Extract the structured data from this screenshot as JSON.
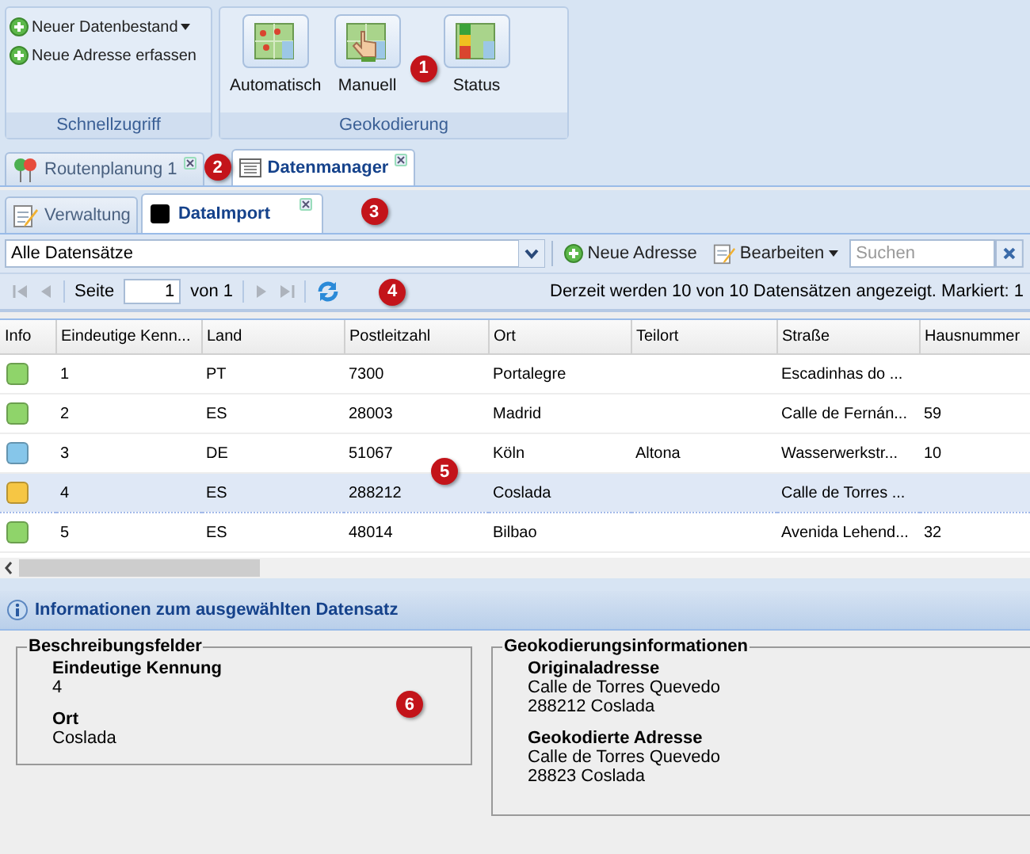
{
  "quick_access": {
    "title": "Schnellzugriff",
    "items": [
      {
        "label": "Neuer Datenbestand",
        "dropdown": true
      },
      {
        "label": "Neue Adresse erfassen",
        "dropdown": false
      }
    ]
  },
  "geocoding": {
    "title": "Geokodierung",
    "buttons": [
      {
        "label": "Automatisch",
        "kind": "auto"
      },
      {
        "label": "Manuell",
        "kind": "manual"
      },
      {
        "label": "Status",
        "kind": "status"
      }
    ],
    "callout": "1"
  },
  "main_tabs": {
    "items": [
      {
        "label": "Routenplanung 1",
        "kind": "pins",
        "selected": false
      },
      {
        "label": "Datenmanager",
        "kind": "window",
        "selected": true
      }
    ],
    "callout": "2"
  },
  "sub_tabs": {
    "items": [
      {
        "label": "Verwaltung",
        "kind": "notepad",
        "selected": false
      },
      {
        "label": "DataImport",
        "kind": "square",
        "selected": true
      }
    ],
    "callout": "3"
  },
  "toolbar": {
    "filter": "Alle Datensätze",
    "new_button": "Neue Adresse",
    "edit_button": "Bearbeiten",
    "search_placeholder": "Suchen"
  },
  "paging": {
    "page_label": "Seite",
    "page": "1",
    "of_label": "von 1",
    "nav_disabled": true,
    "status": "Derzeit werden 10 von 10 Datensätzen angezeigt. Markiert: 1",
    "callout": "4"
  },
  "grid": {
    "columns": [
      "Info",
      "Eindeutige Kenn...",
      "Land",
      "Postleitzahl",
      "Ort",
      "Teilort",
      "Straße",
      "Hausnummer"
    ],
    "rows": [
      {
        "color": "#8fd46a",
        "selected": false,
        "cells": [
          "",
          "1",
          "PT",
          "7300",
          "Portalegre",
          "",
          "Escadinhas do ...",
          ""
        ]
      },
      {
        "color": "#8fd46a",
        "selected": false,
        "cells": [
          "",
          "2",
          "ES",
          "28003",
          "Madrid",
          "",
          "Calle de Fernán...",
          "59"
        ]
      },
      {
        "color": "#86c6ea",
        "selected": false,
        "cells": [
          "",
          "3",
          "DE",
          "51067",
          "Köln",
          "Altona",
          "Wasserwerkstr...",
          "10"
        ]
      },
      {
        "color": "#f6c644",
        "selected": true,
        "cells": [
          "",
          "4",
          "ES",
          "288212",
          "Coslada",
          "",
          "Calle de Torres ...",
          ""
        ]
      },
      {
        "color": "#8fd46a",
        "selected": false,
        "cells": [
          "",
          "5",
          "ES",
          "48014",
          "Bilbao",
          "",
          "Avenida Lehend...",
          "32"
        ]
      }
    ],
    "callout": "5"
  },
  "info": {
    "title": "Informationen zum ausgewählten Datensatz",
    "description": {
      "title": "Beschreibungsfelder",
      "fields": [
        {
          "label": "Eindeutige Kennung",
          "lines": [
            "4"
          ]
        },
        {
          "label": "Ort",
          "lines": [
            "Coslada"
          ]
        }
      ],
      "callout": "6"
    },
    "geocoding_info": {
      "title": "Geokodierungsinformationen",
      "fields": [
        {
          "label": "Originaladresse",
          "lines": [
            "Calle de Torres Quevedo",
            "288212 Coslada"
          ]
        },
        {
          "label": "Geokodierte Adresse",
          "lines": [
            "Calle de Torres Quevedo",
            "28823 Coslada"
          ]
        }
      ]
    }
  }
}
